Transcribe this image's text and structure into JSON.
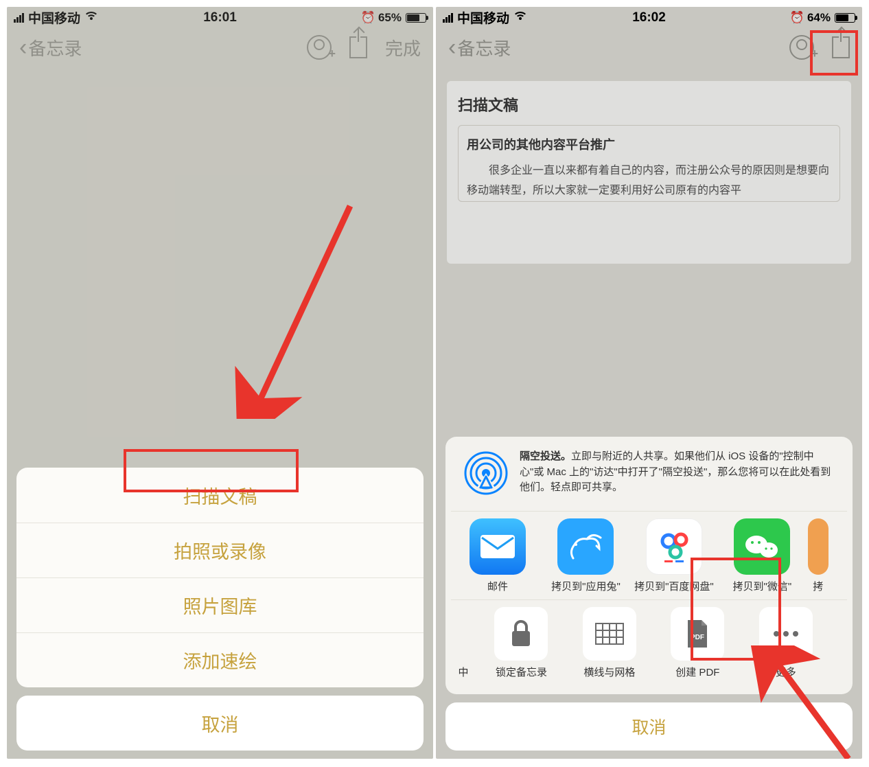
{
  "left": {
    "status": {
      "carrier": "中国移动",
      "time": "16:01",
      "battery": "65%"
    },
    "nav": {
      "back": "备忘录",
      "done": "完成"
    },
    "sheet": {
      "items": [
        "扫描文稿",
        "拍照或录像",
        "照片图库",
        "添加速绘"
      ],
      "cancel": "取消"
    }
  },
  "right": {
    "status": {
      "carrier": "中国移动",
      "time": "16:02",
      "battery": "64%"
    },
    "nav": {
      "back": "备忘录"
    },
    "doc": {
      "title": "扫描文稿",
      "subtitle": "用公司的其他内容平台推广",
      "body": "很多企业一直以来都有着自己的内容，而注册公众号的原因则是想要向移动端转型，所以大家就一定要利用好公司原有的内容平"
    },
    "airdrop": {
      "title": "隔空投送。",
      "text": "立即与附近的人共享。如果他们从 iOS 设备的\"控制中心\"或 Mac 上的\"访达\"中打开了\"隔空投送\"，那么您将可以在此处看到他们。轻点即可共享。"
    },
    "apps": [
      {
        "label": "邮件",
        "color": "#1e9df4"
      },
      {
        "label": "拷贝到\"应用兔\"",
        "color": "#29a6ff"
      },
      {
        "label": "拷贝到\"百度网盘\"",
        "color": "#ffffff"
      },
      {
        "label": "拷贝到\"微信\"",
        "color": "#2dc84c"
      },
      {
        "label": "拷",
        "color": ""
      }
    ],
    "actions": [
      {
        "label": "中",
        "icon": ""
      },
      {
        "label": "锁定备忘录",
        "icon": "lock"
      },
      {
        "label": "横线与网格",
        "icon": "grid"
      },
      {
        "label": "创建 PDF",
        "icon": "pdf"
      },
      {
        "label": "更多",
        "icon": "dots"
      }
    ],
    "cancel": "取消"
  }
}
